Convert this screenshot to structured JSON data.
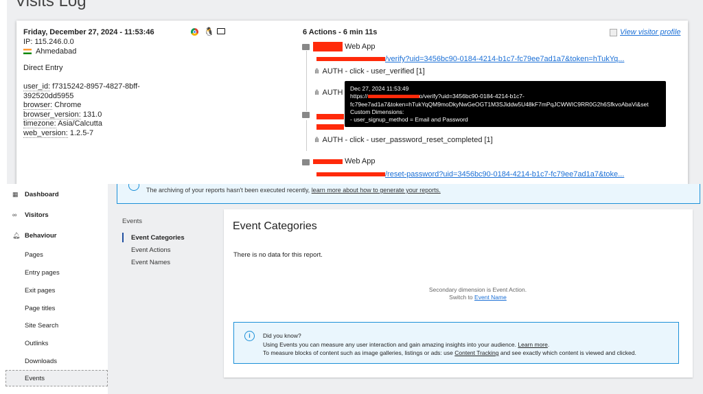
{
  "visits_log": {
    "title": "Visits Log",
    "visit": {
      "datetime": "Friday, December 27, 2024 - 11:53:46",
      "ip": "IP: 115.246.0.0",
      "city": "Ahmedabad",
      "referrer": "Direct Entry",
      "custom": [
        {
          "label": "user_id:",
          "value": " f7315242-8957-4827-8bff-392520dd5955"
        },
        {
          "label": "browser:",
          "value": " Chrome"
        },
        {
          "label": "browser_version:",
          "value": " 131.0"
        },
        {
          "label": "timezone:",
          "value": " Asia/Calcutta"
        },
        {
          "label": "web_version:",
          "value": " 1.2.5-7"
        }
      ],
      "icons": [
        "chrome-icon",
        "linux-icon",
        "desktop-icon"
      ],
      "actions_summary": "6 Actions - 6 min 11s",
      "view_profile": "View visitor profile",
      "pages": [
        {
          "title": "Web App",
          "url": "/verify?uid=3456bc90-0184-4214-b1c7-fc79ee7ad1a7&token=hTukYq...",
          "events": [
            "AUTH - click - user_verified [1]",
            "AUTH"
          ]
        },
        {
          "title": "",
          "url": "",
          "events": [
            "AUTH - click - user_password_reset_completed [1]"
          ]
        },
        {
          "title": "Web App",
          "url": "/reset-password?uid=3456bc90-0184-4214-b1c7-fc79ee7ad1a7&toke...",
          "events": []
        }
      ],
      "tooltip": {
        "line1": "Dec 27, 2024 11:53:49",
        "line2a": "https://",
        "line2b": "o/verify?uid=3456bc90-0184-4214-b1c7-",
        "line3": "fc79ee7ad1a7&token=hTukYqQM9moDkyNwGeOGT1M3SJiddw5U48kF7mPqJCWWIC9RR0G2h6SfkvoAbaVi&set",
        "line4": "Custom Dimensions:",
        "line5": "- user_signup_method = Email and Password"
      }
    }
  },
  "sidebar": {
    "sections": [
      {
        "label": "Dashboard",
        "icon": "dashboard-icon"
      },
      {
        "label": "Visitors",
        "icon": "visitors-icon"
      },
      {
        "label": "Behaviour",
        "icon": "bell-icon"
      }
    ],
    "items": [
      "Pages",
      "Entry pages",
      "Exit pages",
      "Page titles",
      "Site Search",
      "Outlinks",
      "Downloads",
      "Events"
    ],
    "active": "Events"
  },
  "banner": {
    "text": "The archiving of your reports hasn't been executed recently, ",
    "link": "learn more about how to generate your reports."
  },
  "submenu": {
    "heading": "Events",
    "items": [
      "Event Categories",
      "Event Actions",
      "Event Names"
    ],
    "active": "Event Categories"
  },
  "report": {
    "title": "Event Categories",
    "empty": "There is no data for this report.",
    "secondary": "Secondary dimension is Event Action.",
    "switch_to": "Switch to ",
    "switch_link": "Event Name",
    "tip": {
      "heading": "Did you know?",
      "line1": "Using Events you can measure any user interaction and gain amazing insights into your audience. ",
      "line1_link": "Learn more",
      "line2a": "To measure blocks of content such as image galleries, listings or ads: use ",
      "line2_link": "Content Tracking",
      "line2b": " and see exactly which content is viewed and clicked."
    }
  },
  "colors": {
    "accent": "#1a8fd8",
    "redaction": "#ff2a0a",
    "link": "#1a6fd6"
  }
}
